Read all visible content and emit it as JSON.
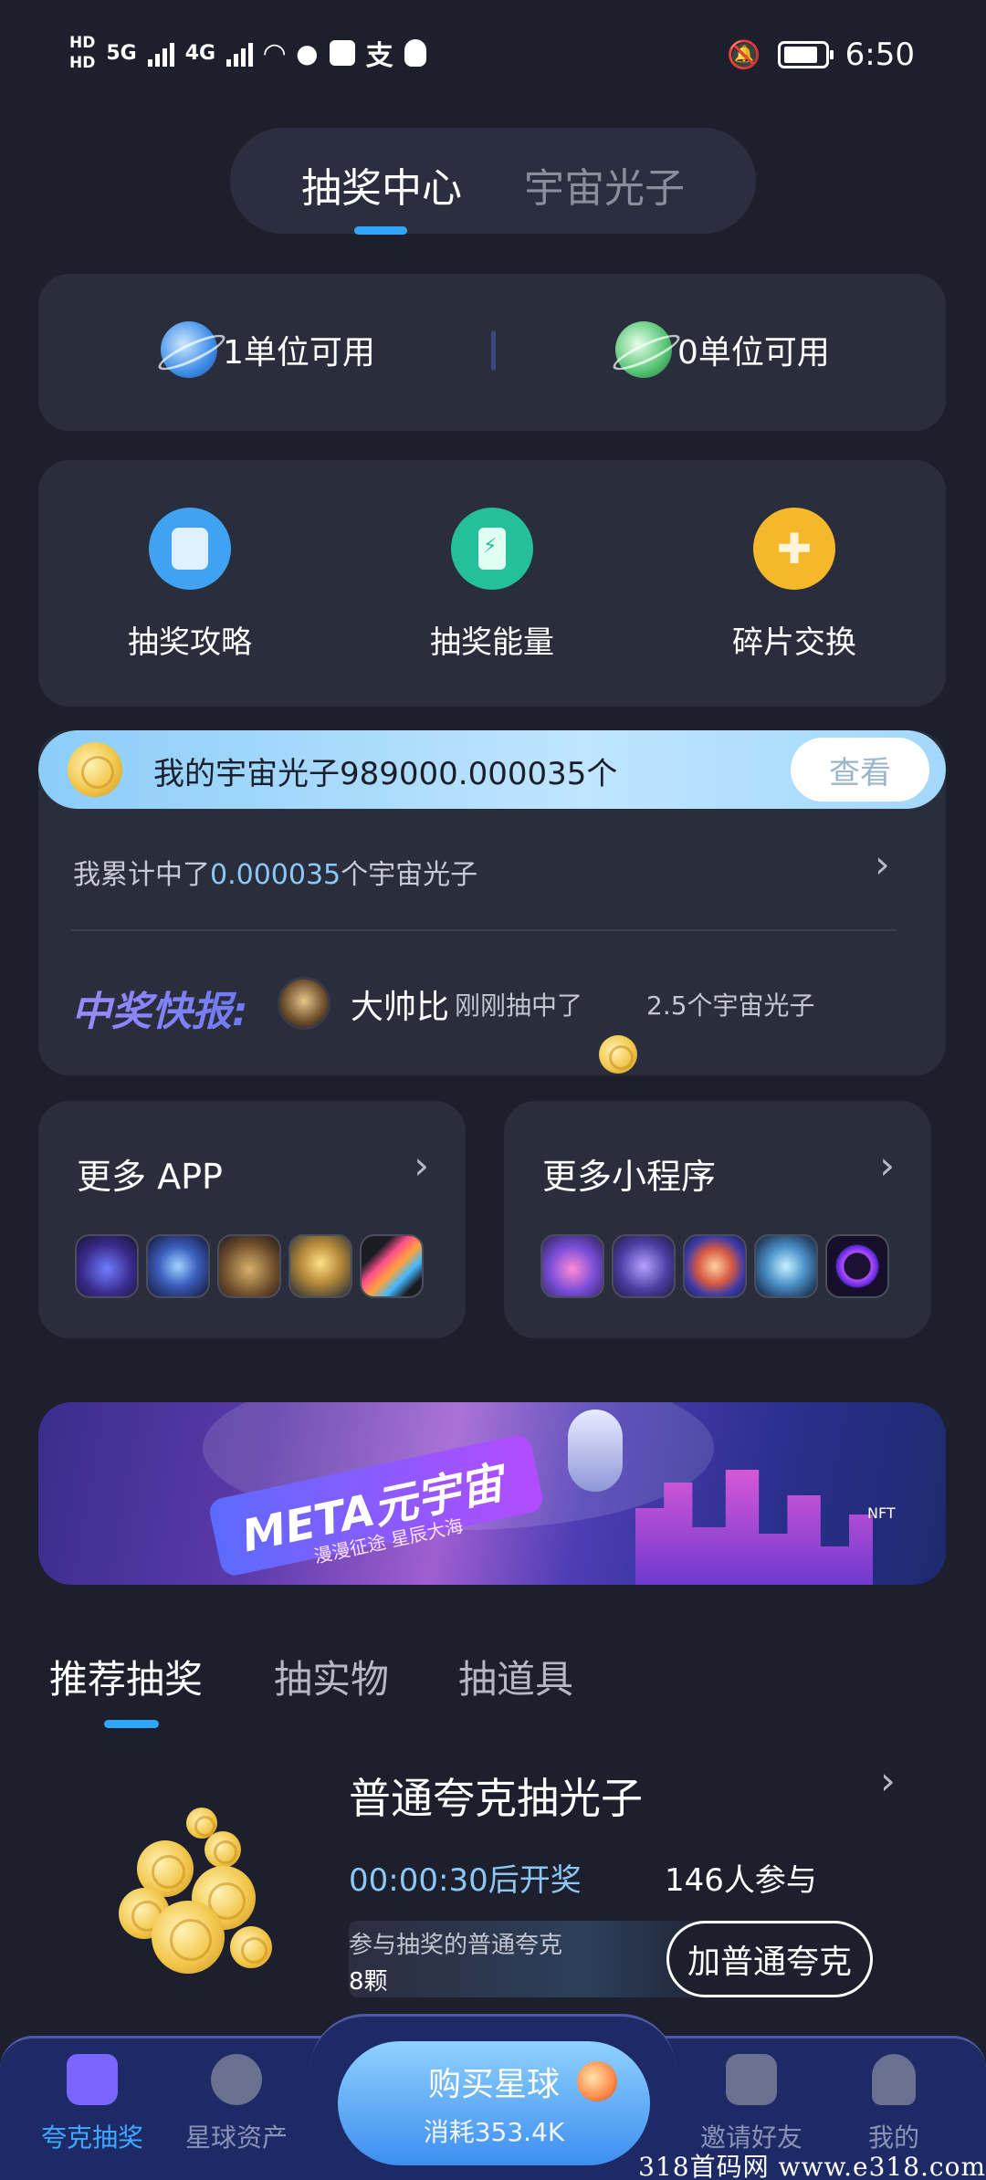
{
  "status_bar": {
    "hd1": "HD",
    "hd2": "HD",
    "net1": "5G",
    "net2": "4G",
    "alipay": "支",
    "time": "6:50",
    "icons": [
      "wifi-icon",
      "wechat-icon",
      "app-icon",
      "alipay-icon",
      "qq-icon",
      "mute-bell-icon",
      "battery-icon"
    ]
  },
  "top_tabs": {
    "active": "抽奖中心",
    "other": "宇宙光子"
  },
  "units": {
    "left": "1单位可用",
    "right": "0单位可用"
  },
  "quick_actions": [
    {
      "label": "抽奖攻略",
      "icon": "guide-icon",
      "color": "#3fa2f2"
    },
    {
      "label": "抽奖能量",
      "icon": "energy-icon",
      "color": "#25bf9a"
    },
    {
      "label": "碎片交换",
      "icon": "puzzle-icon",
      "color": "#f5b82b"
    }
  ],
  "photon": {
    "my_total": "我的宇宙光子989000.000035个",
    "view_button": "查看",
    "acc_prefix": "我累计中了",
    "acc_value": "0.000035",
    "acc_suffix": "个宇宙光子"
  },
  "news": {
    "label": "中奖快报:",
    "user": "大帅比",
    "action": "刚刚抽中了",
    "amount": "2.5个宇宙光子"
  },
  "more": {
    "apps_title": "更多 APP",
    "mini_title": "更多小程序"
  },
  "banner": {
    "title": "META元宇宙",
    "subtitle": "漫漫征途  星辰大海",
    "tag": "NFT"
  },
  "category_tabs": [
    "推荐抽奖",
    "抽实物",
    "抽道具"
  ],
  "lottery": {
    "title": "普通夸克抽光子",
    "timer": "00:00:30后开奖",
    "participants": "146人参与",
    "bar_label": "参与抽奖的普通夸克",
    "bar_value": "8颗",
    "action_button": "加普通夸克"
  },
  "bottom_nav": {
    "items": [
      "夸克抽奖",
      "星球资产",
      "邀请好友",
      "我的"
    ],
    "buy_title": "购买星球",
    "buy_sub": "消耗353.4K"
  },
  "watermark": "318首码网  www.e318.com"
}
